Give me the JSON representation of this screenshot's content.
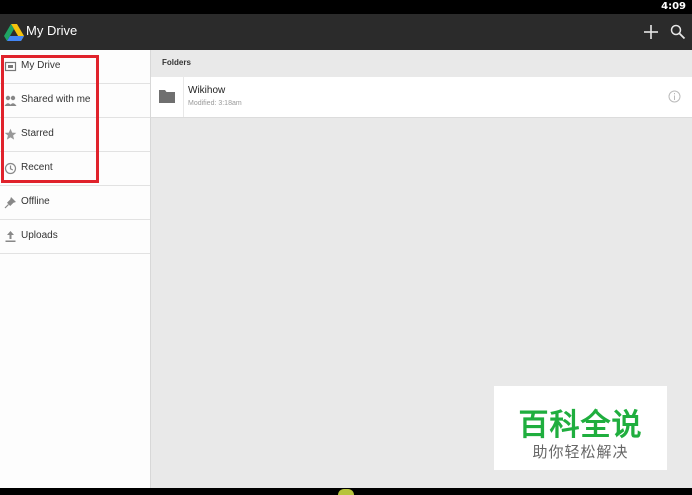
{
  "status_bar": {
    "time": "4:09"
  },
  "action_bar": {
    "title": "My Drive",
    "actions": [
      "add-icon",
      "search-icon"
    ]
  },
  "sidebar": {
    "items": [
      {
        "label": "My Drive",
        "icon": "my-drive-icon"
      },
      {
        "label": "Shared with me",
        "icon": "people-icon"
      },
      {
        "label": "Starred",
        "icon": "star-icon"
      },
      {
        "label": "Recent",
        "icon": "clock-icon"
      },
      {
        "label": "Offline",
        "icon": "pin-icon"
      },
      {
        "label": "Uploads",
        "icon": "upload-icon"
      }
    ]
  },
  "annotation": {
    "highlight_color": "#e0222b"
  },
  "main": {
    "section_header": "Folders",
    "folders": [
      {
        "name": "Wikihow",
        "modified": "Modified: 3:18am"
      }
    ]
  },
  "watermark": {
    "title": "百科全说",
    "subtitle": "助你轻松解决",
    "color": "#1fae3e"
  }
}
